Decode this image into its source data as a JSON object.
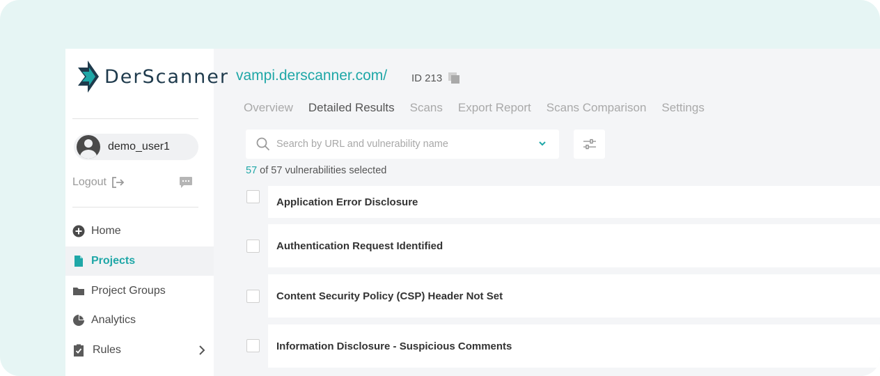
{
  "brand": {
    "name_part1": "Der",
    "name_part2": "Scanner",
    "accent": "#1fa7a7",
    "dark": "#1e3a4c"
  },
  "user": {
    "name": "demo_user1",
    "logout_label": "Logout"
  },
  "nav": [
    {
      "label": "Home",
      "icon": "plus-circle-icon"
    },
    {
      "label": "Projects",
      "icon": "document-icon",
      "active": true
    },
    {
      "label": "Project Groups",
      "icon": "folder-icon"
    },
    {
      "label": "Analytics",
      "icon": "pie-chart-icon"
    },
    {
      "label": "Rules",
      "icon": "clipboard-check-icon"
    }
  ],
  "project": {
    "title": "vampi.derscanner.com/",
    "id_label": "ID 213"
  },
  "tabs": [
    {
      "label": "Overview"
    },
    {
      "label": "Detailed Results",
      "active": true
    },
    {
      "label": "Scans"
    },
    {
      "label": "Export Report"
    },
    {
      "label": "Scans Comparison"
    },
    {
      "label": "Settings"
    }
  ],
  "search": {
    "placeholder": "Search by URL and vulnerability name"
  },
  "selection": {
    "selected": "57",
    "rest": " of  57 vulnerabilities selected"
  },
  "vulnerabilities": [
    {
      "name": "Application Error Disclosure"
    },
    {
      "name": "Authentication Request Identified"
    },
    {
      "name": "Content Security Policy (CSP) Header Not Set"
    },
    {
      "name": "Information Disclosure - Suspicious Comments"
    }
  ]
}
